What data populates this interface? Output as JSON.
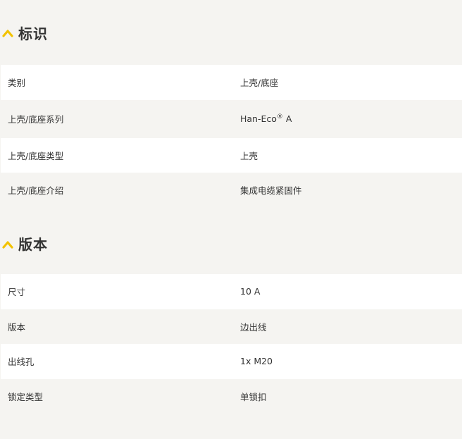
{
  "sections": [
    {
      "title": "标识",
      "rows": [
        {
          "label": "类别",
          "value": "上壳/底座"
        },
        {
          "label": "上壳/底座系列",
          "value": "Han-Eco",
          "value_sup": "®",
          "value_suffix": " A"
        },
        {
          "label": "上壳/底座类型",
          "value": "上壳"
        },
        {
          "label": "上壳/底座介绍",
          "value": "集成电缆紧固件"
        }
      ]
    },
    {
      "title": "版本",
      "rows": [
        {
          "label": "尺寸",
          "value": "10 A"
        },
        {
          "label": "版本",
          "value": "边出线"
        },
        {
          "label": "出线孔",
          "value": "1x M20"
        },
        {
          "label": "锁定类型",
          "value": "单锁扣"
        }
      ]
    }
  ],
  "colors": {
    "accent_chevron": "#f2c200",
    "row_white": "#ffffff",
    "row_gray": "#f5f4f1",
    "text": "#333333"
  },
  "icons": {
    "collapse": "chevron-up-icon"
  }
}
